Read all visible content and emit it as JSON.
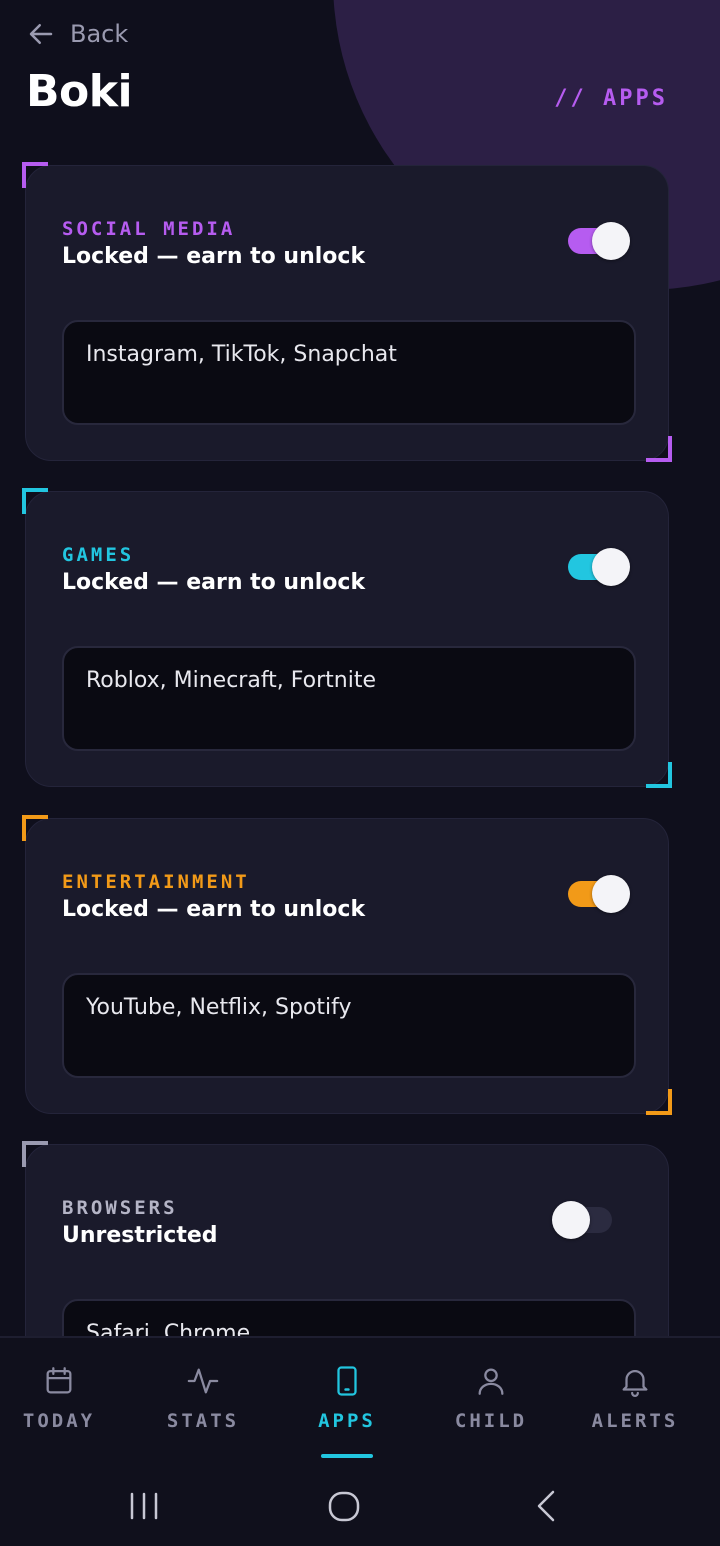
{
  "header": {
    "back_label": "Back",
    "title": "Boki",
    "section_tag": "// APPS"
  },
  "colors": {
    "background": "#0f0f1c",
    "card": "#1a1a2b",
    "purple": "#b65cf0",
    "cyan": "#22c6e0",
    "orange": "#f29a18",
    "gray": "#9a9ab0"
  },
  "categories": [
    {
      "label": "SOCIAL MEDIA",
      "status": "Locked — earn to unlock",
      "apps": "Instagram, TikTok, Snapchat",
      "enabled": true,
      "color": "#b65cf0"
    },
    {
      "label": "GAMES",
      "status": "Locked — earn to unlock",
      "apps": "Roblox, Minecraft, Fortnite",
      "enabled": true,
      "color": "#22c6e0"
    },
    {
      "label": "ENTERTAINMENT",
      "status": "Locked — earn to unlock",
      "apps": "YouTube, Netflix, Spotify",
      "enabled": true,
      "color": "#f29a18"
    },
    {
      "label": "BROWSERS",
      "status": "Unrestricted",
      "apps": "Safari, Chrome",
      "enabled": false,
      "color": "#9a9ab0"
    }
  ],
  "nav": {
    "items": [
      {
        "label": "TODAY",
        "icon": "calendar-icon"
      },
      {
        "label": "STATS",
        "icon": "activity-icon"
      },
      {
        "label": "APPS",
        "icon": "phone-icon",
        "active": true
      },
      {
        "label": "CHILD",
        "icon": "user-icon"
      },
      {
        "label": "ALERTS",
        "icon": "bell-icon"
      }
    ]
  },
  "system_nav": [
    "recents-icon",
    "home-icon",
    "back-icon"
  ]
}
